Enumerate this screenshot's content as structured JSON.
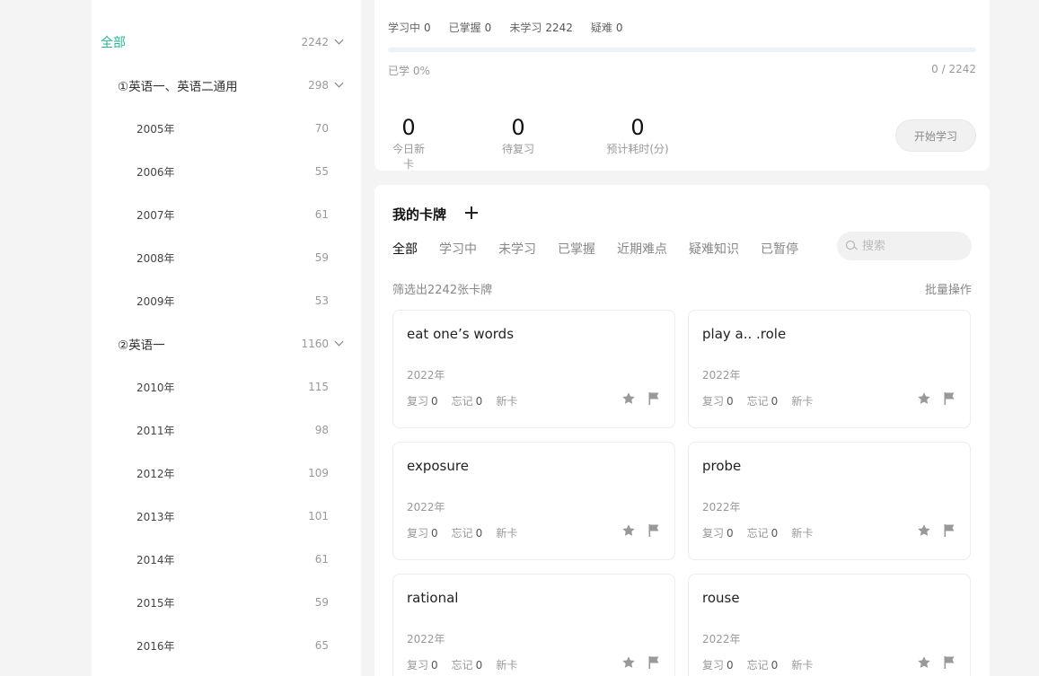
{
  "sidebar": {
    "root": {
      "label": "全部",
      "count": "2242"
    },
    "groups": [
      {
        "label": "①英语一、英语二通用",
        "count": "298",
        "years": [
          {
            "label": "2005年",
            "count": "70"
          },
          {
            "label": "2006年",
            "count": "55"
          },
          {
            "label": "2007年",
            "count": "61"
          },
          {
            "label": "2008年",
            "count": "59"
          },
          {
            "label": "2009年",
            "count": "53"
          }
        ]
      },
      {
        "label": "②英语一",
        "count": "1160",
        "years": [
          {
            "label": "2010年",
            "count": "115"
          },
          {
            "label": "2011年",
            "count": "98"
          },
          {
            "label": "2012年",
            "count": "109"
          },
          {
            "label": "2013年",
            "count": "101"
          },
          {
            "label": "2014年",
            "count": "61"
          },
          {
            "label": "2015年",
            "count": "59"
          },
          {
            "label": "2016年",
            "count": "65"
          }
        ]
      }
    ]
  },
  "stats": {
    "learning_label": "学习中",
    "learning": "0",
    "mastered_label": "已掌握",
    "mastered": "0",
    "unlearned_label": "未学习",
    "unlearned": "2242",
    "hard_label": "疑难",
    "hard": "0",
    "progress_fraction": 0,
    "progress_text": "已学 0%",
    "progress_count": "0 / 2242",
    "today_new": "0",
    "today_new_label": "今日新卡",
    "to_review": "0",
    "to_review_label": "待复习",
    "est_time": "0",
    "est_time_label": "预计耗时(分)",
    "start_label": "开始学习"
  },
  "deck": {
    "title": "我的卡牌",
    "tabs": [
      "全部",
      "学习中",
      "未学习",
      "已掌握",
      "近期难点",
      "疑难知识",
      "已暂停"
    ],
    "active_tab": 0,
    "search_placeholder": "搜索",
    "filter_text": "筛选出2242张卡牌",
    "batch_label": "批量操作",
    "card_labels": {
      "review": "复习",
      "forget": "忘记"
    },
    "cards": [
      {
        "word": "eat one’s words",
        "year": "2022年",
        "review": "0",
        "forget": "0",
        "status": "新卡"
      },
      {
        "word": "play a.. .role",
        "year": "2022年",
        "review": "0",
        "forget": "0",
        "status": "新卡"
      },
      {
        "word": "exposure",
        "year": "2022年",
        "review": "0",
        "forget": "0",
        "status": "新卡"
      },
      {
        "word": "probe",
        "year": "2022年",
        "review": "0",
        "forget": "0",
        "status": "新卡"
      },
      {
        "word": "rational",
        "year": "2022年",
        "review": "0",
        "forget": "0",
        "status": "新卡"
      },
      {
        "word": "rouse",
        "year": "2022年",
        "review": "0",
        "forget": "0",
        "status": "新卡"
      }
    ]
  },
  "colors": {
    "accent": "#2bb39a",
    "icon": "#999999"
  }
}
